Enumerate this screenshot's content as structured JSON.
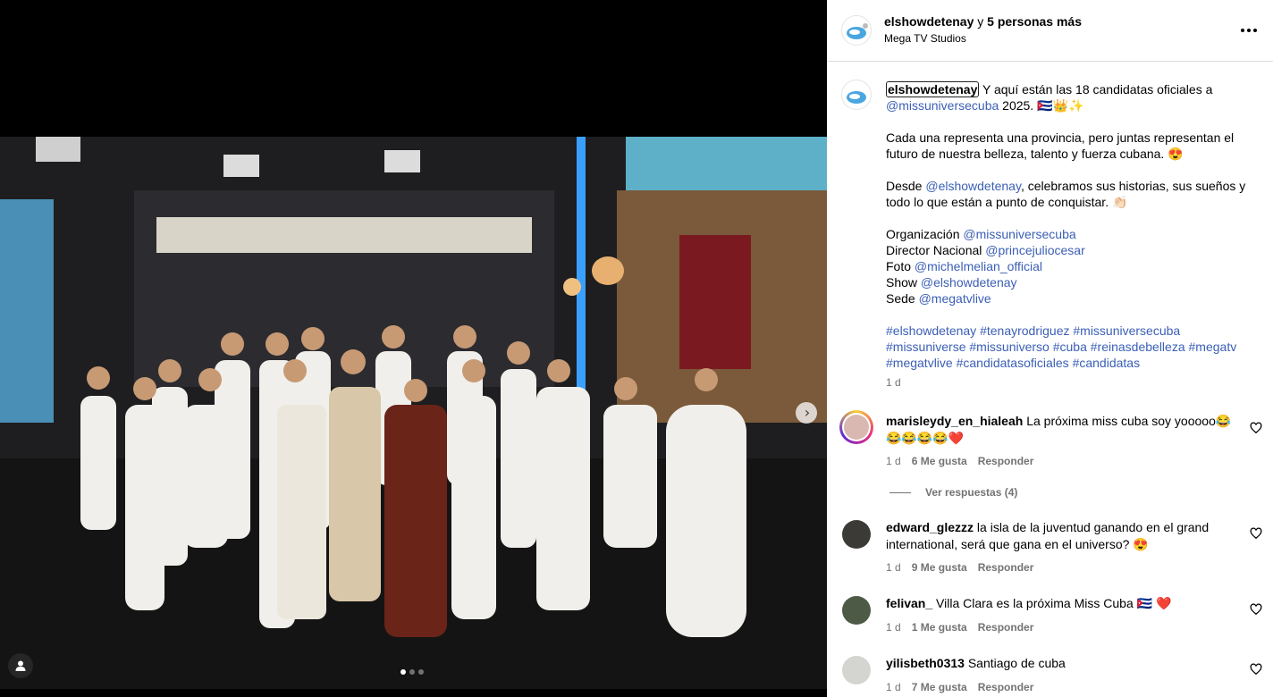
{
  "header": {
    "username": "elshowdetenay",
    "joiner": "y",
    "others": "5 personas más",
    "location": "Mega TV Studios"
  },
  "media": {
    "slide_count": 3,
    "active_slide": 1
  },
  "caption": {
    "username": "elshowdetenay",
    "line1_text": " Y aquí están las 18 candidatas oficiales a",
    "line1_mention": "@missuniversecuba",
    "line1_tail": " 2025. 🇨🇺👑✨",
    "para2": "Cada una representa una provincia, pero juntas representan el futuro de nuestra belleza, talento y fuerza cubana. 😍",
    "para3_prefix": "Desde ",
    "para3_mention": "@elshowdetenay",
    "para3_text": ", celebramos sus historias, sus sueños y todo lo que están a punto de conquistar. 👏🏻",
    "credits": [
      {
        "label": "Organización ",
        "mention": "@missuniversecuba"
      },
      {
        "label": "Director Nacional ",
        "mention": "@princejuliocesar"
      },
      {
        "label": "Foto ",
        "mention": "@michelmelian_official"
      },
      {
        "label": "Show ",
        "mention": "@elshowdetenay"
      },
      {
        "label": "Sede ",
        "mention": "@megatvlive"
      }
    ],
    "hashtags_line1": "#elshowdetenay #tenayrodriguez #missuniversecuba",
    "hashtags_line2": "#missuniverse #missuniverso #cuba #reinasdebelleza #megatv",
    "hashtags_line3": "#megatvlive #candidatasoficiales #candidatas",
    "time": "1 d"
  },
  "comments": [
    {
      "user": "marisleydy_en_hialeah",
      "text": " La próxima miss cuba soy yooooo😂😂😂😂😂❤️",
      "time": "1 d",
      "likes": "6 Me gusta",
      "reply": "Responder",
      "replies": "Ver respuestas (4)"
    },
    {
      "user": "edward_glezzz",
      "text": " la isla de la juventud ganando en el grand international, será que gana en el universo? 😍",
      "time": "1 d",
      "likes": "9 Me gusta",
      "reply": "Responder"
    },
    {
      "user": "felivan_",
      "text": " Villa Clara es la próxima Miss Cuba 🇨🇺 ❤️",
      "time": "1 d",
      "likes": "1 Me gusta",
      "reply": "Responder"
    },
    {
      "user": "yilisbeth0313",
      "text": " Santiago de cuba",
      "time": "1 d",
      "likes": "7 Me gusta",
      "reply": "Responder"
    }
  ],
  "colors": {
    "link": "#3b5fb5",
    "muted": "#737373",
    "divider": "#dbdbdb"
  }
}
